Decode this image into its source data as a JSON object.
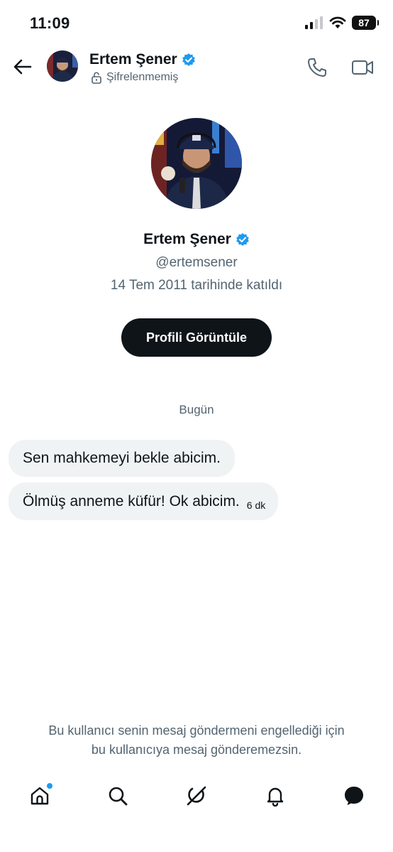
{
  "status_bar": {
    "time": "11:09",
    "battery": "87"
  },
  "header": {
    "name": "Ertem Şener",
    "encryption_status": "Şifrelenmemiş"
  },
  "profile": {
    "name": "Ertem Şener",
    "handle": "@ertemsener",
    "joined": "14 Tem 2011 tarihinde katıldı",
    "view_profile_label": "Profili Görüntüle"
  },
  "conversation": {
    "date_label": "Bugün",
    "messages": [
      {
        "text": "Sen mahkemeyi bekle abicim.",
        "time": ""
      },
      {
        "text": "Ölmüş anneme küfür! Ok abicim.",
        "time": "6 dk"
      }
    ]
  },
  "blocked_notice": {
    "line1": "Bu kullanıcı senin mesaj göndermeni engellediği için",
    "line2": "bu kullanıcıya mesaj gönderemezsin."
  },
  "colors": {
    "verified": "#1d9bf0",
    "secondary_text": "#536471",
    "bubble": "#eff3f4",
    "primary_button": "#0f1419"
  }
}
